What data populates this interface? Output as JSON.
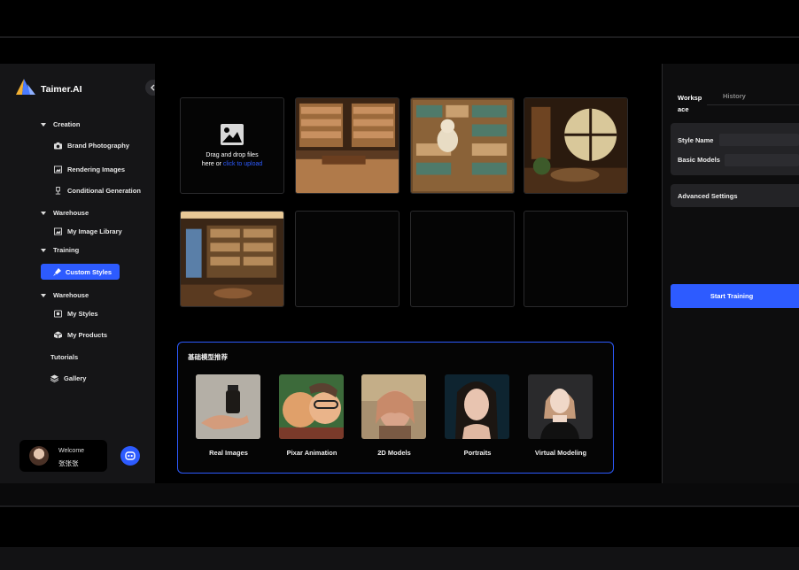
{
  "app": {
    "name": "Taimer.AI"
  },
  "sidebar": {
    "sections": [
      {
        "label": "Creation"
      },
      {
        "label": "Warehouse"
      },
      {
        "label": "Training"
      },
      {
        "label": "Warehouse"
      }
    ],
    "items": {
      "brand_photography": "Brand Photography",
      "rendering_images": "Rendering Images",
      "conditional_generation": "Conditional Generation",
      "my_image_library": "My Image Library",
      "custom_styles": "Custom Styles",
      "my_styles": "My Styles",
      "my_products": "My Products",
      "tutorials": "Tutorials",
      "gallery": "Gallery"
    },
    "active_item": "Custom Styles"
  },
  "user": {
    "welcome": "Welcome",
    "name": "张张张"
  },
  "upload": {
    "text": "Drag and drop files here or",
    "link": "click to upload"
  },
  "recommendations": {
    "title": "基础模型推荐",
    "items": [
      {
        "label": "Real Images"
      },
      {
        "label": "Pixar Animation"
      },
      {
        "label": "2D Models"
      },
      {
        "label": "Portraits"
      },
      {
        "label": "Virtual Modeling"
      }
    ]
  },
  "right_panel": {
    "tabs": [
      {
        "label": "Worksp ace"
      },
      {
        "label": "History"
      }
    ],
    "style_name_label": "Style Name",
    "basic_models_label": "Basic Models",
    "advanced_settings_label": "Advanced Settings",
    "start_button": "Start Training"
  },
  "colors": {
    "accent": "#2D5BFF",
    "background": "#000000",
    "sidebar": "#151517"
  }
}
